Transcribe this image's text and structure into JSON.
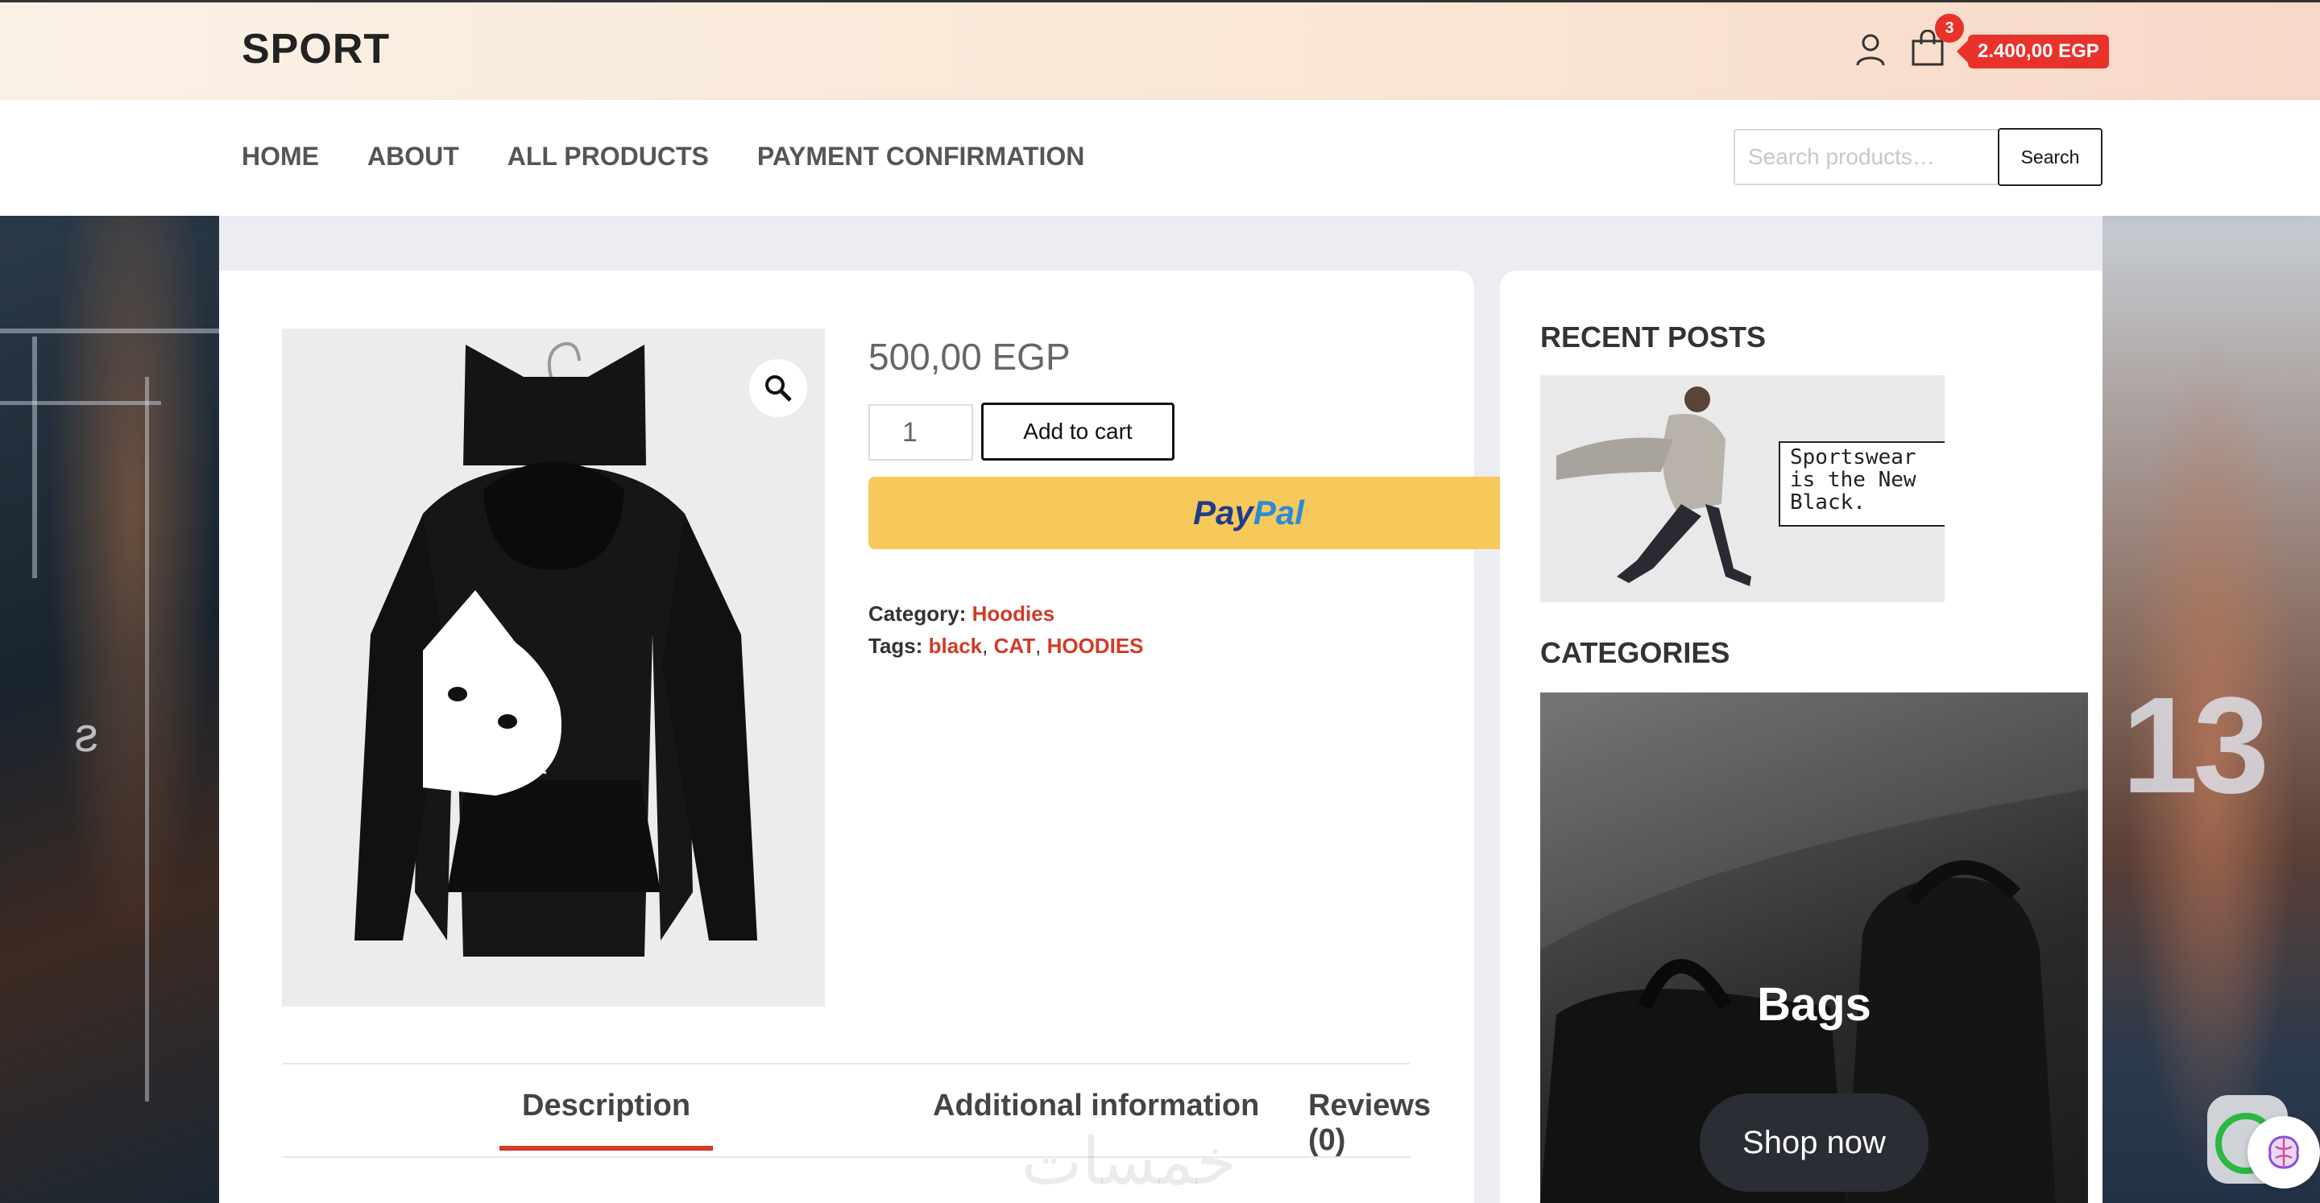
{
  "site": {
    "brand": "SPORT"
  },
  "header": {
    "cart_count": "3",
    "cart_total": "2.400,00 EGP"
  },
  "nav": {
    "items": [
      "HOME",
      "ABOUT",
      "ALL PRODUCTS",
      "PAYMENT CONFIRMATION"
    ],
    "search_placeholder": "Search products…",
    "search_button": "Search"
  },
  "product": {
    "price": "500,00 EGP",
    "quantity": "1",
    "add_to_cart": "Add to cart",
    "paypal_part1": "Pay",
    "paypal_part2": "Pal",
    "category_label": "Category:",
    "category": "Hoodies",
    "tags_label": "Tags:",
    "tags": [
      "black",
      "CAT",
      "HOODIES"
    ]
  },
  "tabs": [
    "Description",
    "Additional information",
    "Reviews (0)"
  ],
  "sidebar": {
    "recent_posts_heading": "RECENT POSTS",
    "post_caption_lines": [
      "Sportswear",
      "is the New",
      "Black."
    ],
    "categories_heading": "CATEGORIES",
    "category_title": "Bags",
    "shop_now": "Shop now"
  },
  "colors": {
    "accent": "#d13b27",
    "cart_badge": "#e8322a",
    "paypal": "#f7c95b"
  }
}
